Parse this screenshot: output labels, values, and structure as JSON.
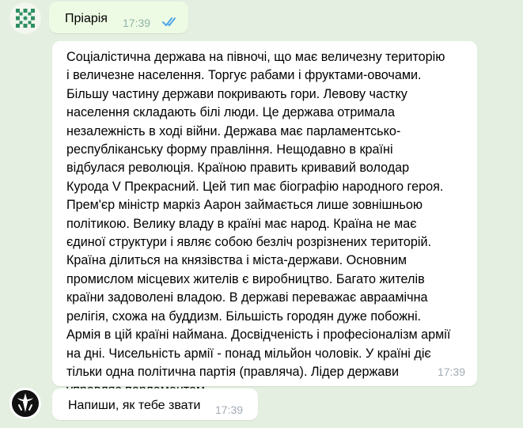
{
  "colors": {
    "background": "#e4efe1",
    "outgoing_bubble": "#eefbe4",
    "incoming_bubble": "#ffffff",
    "timestamp": "#a3acb5",
    "read_check": "#53a6e7"
  },
  "messages": [
    {
      "type": "outgoing",
      "text": "Пріарія",
      "time": "17:39",
      "status": "read",
      "avatar_icon": "green-pattern-avatar-icon"
    },
    {
      "type": "incoming",
      "text": "Соціалістична держава на півночі, що має величезну територію\nі величезне населення. Торгує рабами і фруктами-овочами.\nБільшу частину держави покривають гори. Левову частку\nнаселення складають білі люди. Це держава отримала\nнезалежність в ході війни. Держава має парламентсько-\nреспубліканську форму правління. Нещодавно в країні\nвідбулася революція. Країною править кривавий володар\nКурода V Прекрасний. Цей тип має біографію народного героя.\nПрем'єр міністр маркіз Аарон займається лише зовнішньою\nполітикою. Велику владу в країні має народ. Країна не має\nєдиної структури і являє собою безліч розрізнених територій.\nКраїна ділиться на князівства і міста-держави. Основним\nпромислом місцевих жителів є виробництво. Багато жителів\nкраїни задоволені владою. В державі переважає авраамічна\nрелігія, схожа на буддизм. Більшість городян дуже побожні.\nАрмія в цій країні наймана. Досвідченість і професіоналізм армії\nна дні. Чисельність армії - понад мільйон чоловік. У країні діє\nтільки одна політична партія (правляча). Лідер держави\nуправляє парламентом.",
      "time": "17:39"
    },
    {
      "type": "incoming",
      "text": "Напиши, як тебе звати",
      "time": "17:39",
      "avatar_icon": "black-sword-avatar-icon"
    }
  ]
}
